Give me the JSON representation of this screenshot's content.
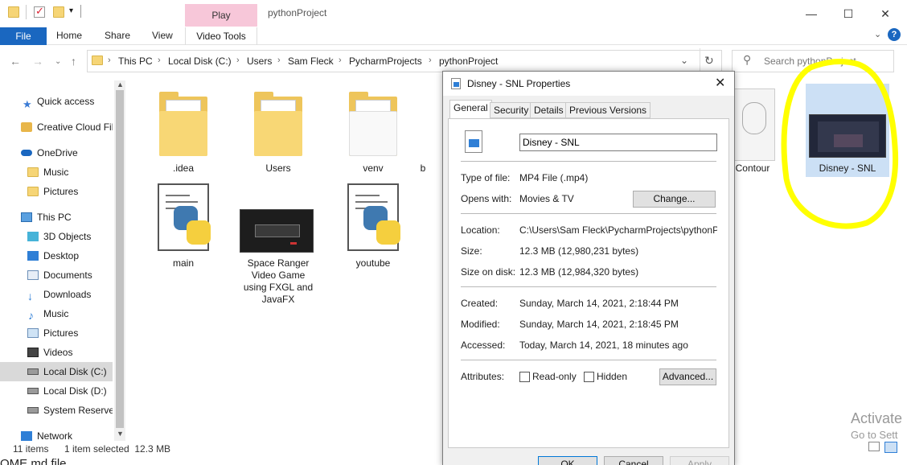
{
  "window": {
    "title": "pythonProject",
    "context_tab": "Play",
    "controls": {
      "minimize": "—",
      "maximize": "☐",
      "close": "✕"
    }
  },
  "ribbon": {
    "file": "File",
    "tabs": [
      "Home",
      "Share",
      "View",
      "Video Tools"
    ]
  },
  "address": {
    "crumbs": [
      "This PC",
      "Local Disk (C:)",
      "Users",
      "Sam Fleck",
      "PycharmProjects",
      "pythonProject"
    ],
    "search_placeholder": "Search pythonProject"
  },
  "sidebar": {
    "items": [
      {
        "label": "Quick access",
        "icon": "star-icon"
      },
      {
        "label": "Creative Cloud Fil",
        "icon": "creative-cloud-icon"
      },
      {
        "label": "OneDrive",
        "icon": "cloud-icon"
      },
      {
        "label": "Music",
        "icon": "folder-icon"
      },
      {
        "label": "Pictures",
        "icon": "folder-icon"
      },
      {
        "label": "This PC",
        "icon": "computer-icon"
      },
      {
        "label": "3D Objects",
        "icon": "cube-icon"
      },
      {
        "label": "Desktop",
        "icon": "desktop-icon"
      },
      {
        "label": "Documents",
        "icon": "documents-icon"
      },
      {
        "label": "Downloads",
        "icon": "download-icon"
      },
      {
        "label": "Music",
        "icon": "music-icon"
      },
      {
        "label": "Pictures",
        "icon": "pictures-icon"
      },
      {
        "label": "Videos",
        "icon": "videos-icon"
      },
      {
        "label": "Local Disk (C:)",
        "icon": "drive-icon"
      },
      {
        "label": "Local Disk (D:)",
        "icon": "drive-icon"
      },
      {
        "label": "System Reserved",
        "icon": "drive-icon"
      },
      {
        "label": "Network",
        "icon": "network-icon"
      }
    ]
  },
  "files": [
    {
      "name": ".idea"
    },
    {
      "name": "Users"
    },
    {
      "name": "venv"
    },
    {
      "name": "b"
    },
    {
      "name": "main"
    },
    {
      "name": "Space Ranger Video Game using FXGL and JavaFX"
    },
    {
      "name": "youtube"
    },
    {
      "name": "Contour"
    },
    {
      "name": "Disney - SNL"
    }
  ],
  "status": {
    "count": "11 items",
    "selection": "1 item selected  12.3 MB"
  },
  "dialog": {
    "title": "Disney - SNL Properties",
    "tabs": [
      "General",
      "Security",
      "Details",
      "Previous Versions"
    ],
    "filename": "Disney - SNL",
    "type_label": "Type of file:",
    "type_value": "MP4 File (.mp4)",
    "opens_label": "Opens with:",
    "opens_value": "Movies & TV",
    "change_button": "Change...",
    "location_label": "Location:",
    "location_value": "C:\\Users\\Sam Fleck\\PycharmProjects\\pythonProjec",
    "size_label": "Size:",
    "size_value": "12.3 MB (12,980,231 bytes)",
    "size_on_disk_label": "Size on disk:",
    "size_on_disk_value": "12.3 MB (12,984,320 bytes)",
    "created_label": "Created:",
    "created_value": "Sunday, March 14, 2021, 2:18:44 PM",
    "modified_label": "Modified:",
    "modified_value": "Sunday, March 14, 2021, 2:18:45 PM",
    "accessed_label": "Accessed:",
    "accessed_value": "Today, March 14, 2021, 18 minutes ago",
    "attributes_label": "Attributes:",
    "readonly_label": "Read-only",
    "hidden_label": "Hidden",
    "advanced_button": "Advanced...",
    "ok_button": "OK",
    "cancel_button": "Cancel",
    "apply_button": "Apply"
  },
  "watermark": {
    "line1": "Activate",
    "line2": "Go to Sett"
  },
  "bottom_peek": "OME.md file",
  "colors": {
    "accent": "#1a67c0",
    "context_tab": "#f7c7d9",
    "annotation": "#ffff00"
  }
}
